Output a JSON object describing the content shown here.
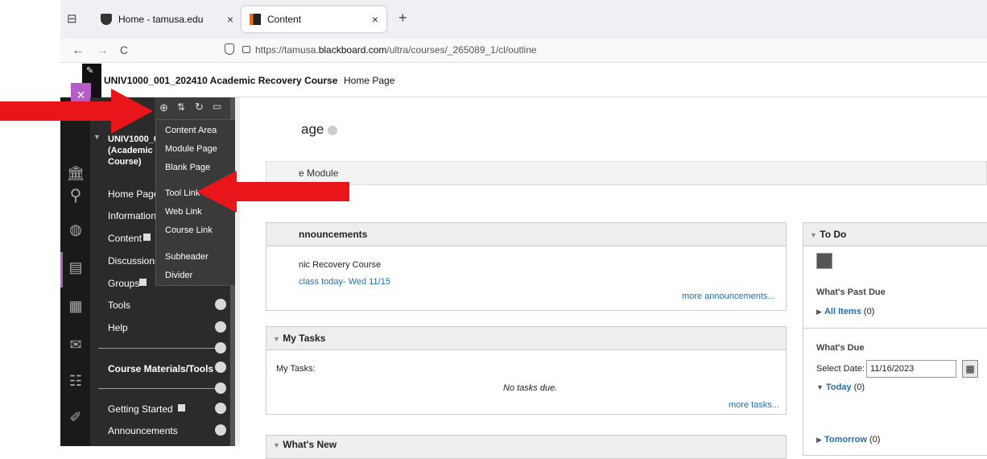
{
  "browser": {
    "tabs": [
      {
        "title": "Home - tamusa.edu",
        "close": "×"
      },
      {
        "title": "Content",
        "close": "×"
      }
    ],
    "new_tab": "+",
    "back": "←",
    "forward": "→",
    "reload": "C",
    "url_prefix": "https://tamusa.",
    "url_domain": "blackboard.com",
    "url_path": "/ultra/courses/_265089_1/cl/outline"
  },
  "course_header": {
    "title": "UNIV1000_001_202410 Academic Recovery Course",
    "crumb": "Home Page"
  },
  "close_label": "×",
  "menu": {
    "course_title_lines": [
      "UNIV1000_0",
      "(Academic",
      "Course)"
    ],
    "items": [
      "Home Page",
      "Information",
      "Content",
      "Discussions",
      "Groups",
      "Tools",
      "Help"
    ],
    "section_header": "Course Materials/Tools",
    "items2": [
      "Getting Started",
      "Announcements"
    ]
  },
  "dropdown": [
    "Content Area",
    "Module Page",
    "Blank Page",
    "Tool Link",
    "Web Link",
    "Course Link",
    "Subheader",
    "Divider"
  ],
  "page": {
    "title_fragment": "age",
    "module_fragment": "e Module"
  },
  "announcements": {
    "heading": "nnouncements",
    "line1": "nic Recovery Course",
    "line2": "class today- Wed 11/15",
    "more": "more announcements..."
  },
  "tasks": {
    "heading": "My Tasks",
    "label": "My Tasks:",
    "empty": "No tasks due.",
    "more": "more tasks..."
  },
  "whats_new": {
    "heading": "What's New"
  },
  "todo": {
    "heading": "To Do",
    "past_due": "What's Past Due",
    "all_items": "All Items",
    "all_items_count": "(0)",
    "due": "What's Due",
    "select_date_label": "Select Date:",
    "date_value": "11/16/2023",
    "today": "Today",
    "today_count": "(0)",
    "tomorrow": "Tomorrow",
    "tomorrow_count": "(0)"
  },
  "colors": {
    "arrow": "#e8161b",
    "close": "#b65cc6",
    "link": "#1f6fb0"
  }
}
